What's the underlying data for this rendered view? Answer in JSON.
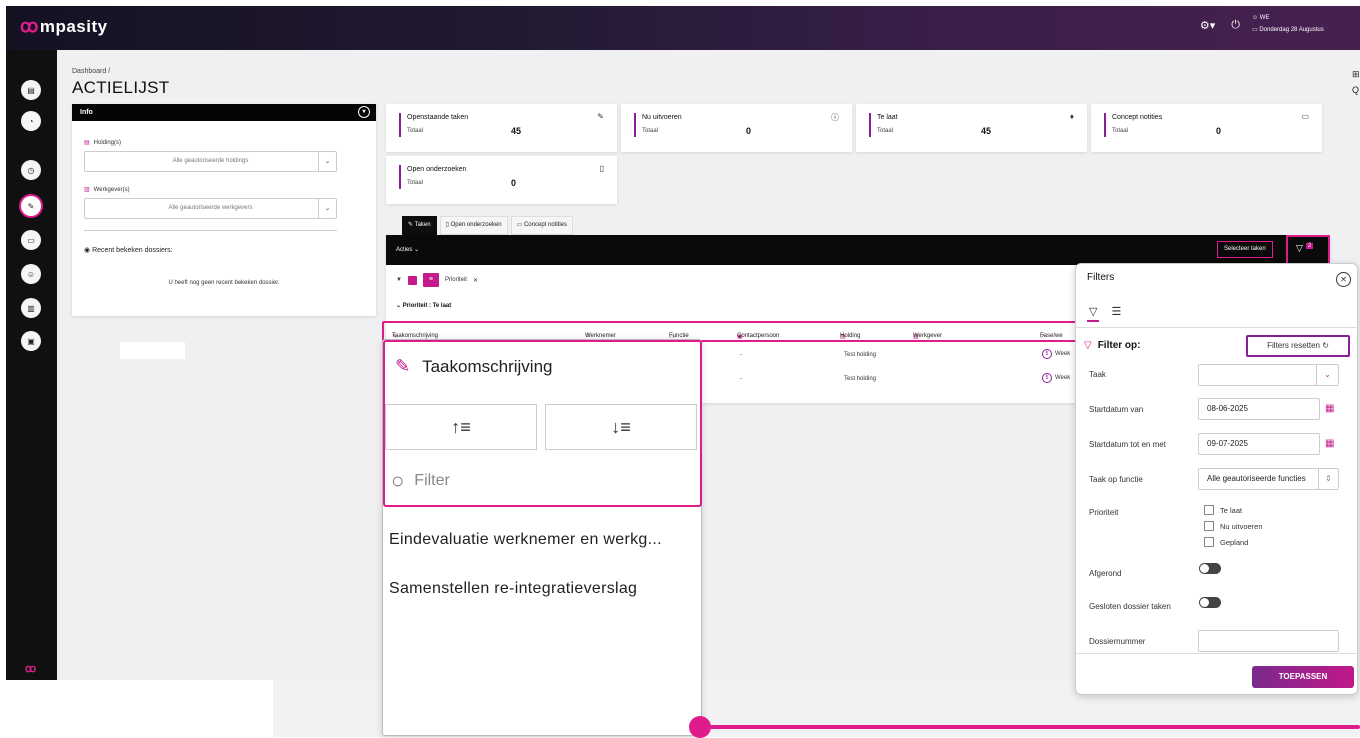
{
  "app": {
    "logo_text": "mpasity"
  },
  "topbar": {
    "user_initials": "WE",
    "date": "Donderdag 28 Augustus"
  },
  "page": {
    "breadcrumb": "Dashboard /",
    "title": "ACTIELIJST"
  },
  "info": {
    "title": "Info",
    "holding_label": "Holding(s)",
    "holding_value": "Alle geautoriseerde holdings",
    "werkgever_label": "Werkgever(s)",
    "werkgever_value": "Alle geautoriseerde werkgevers",
    "recent_label": "Recent bekeken dossiers:",
    "recent_empty": "U heeft nog geen recent bekeken dossier."
  },
  "stats": [
    {
      "title": "Openstaande taken",
      "sub": "Totaal",
      "value": "45",
      "icon": "edit-icon"
    },
    {
      "title": "Nu uitvoeren",
      "sub": "Totaal",
      "value": "0",
      "icon": "info-icon"
    },
    {
      "title": "Te laat",
      "sub": "Totaal",
      "value": "45",
      "icon": "bell-icon"
    },
    {
      "title": "Concept notities",
      "sub": "Totaal",
      "value": "0",
      "icon": "chat-icon"
    },
    {
      "title": "Open onderzoeken",
      "sub": "Totaal",
      "value": "0",
      "icon": "document-icon"
    }
  ],
  "tabs": [
    "Taken",
    "Open onderzoeken",
    "Concept notities"
  ],
  "toolbar": {
    "acties": "Acties",
    "select_tasks": "Selecteer taken",
    "filter_count": "2"
  },
  "grouping": {
    "chip_label": "Prioriteit",
    "group_title": "Prioriteit : Te laat"
  },
  "columns": [
    "Taakomschrijving",
    "Werknemer",
    "Functie",
    "Contactpersoon",
    "Holding",
    "Werkgever",
    "Fase/we"
  ],
  "rows": [
    {
      "contact": "-",
      "holding": "Test holding",
      "fase": "Week"
    },
    {
      "contact": "-",
      "holding": "Test holding",
      "fase": "Week"
    }
  ],
  "column_popup": {
    "title": "Taakomschrijving",
    "filter_placeholder": "Filter",
    "items": [
      "Eindevaluatie werknemer en werkg...",
      "Samenstellen re-integratieverslag"
    ]
  },
  "filters": {
    "title": "Filters",
    "filter_op": "Filter op:",
    "reset": "Filters resetten",
    "taak_label": "Taak",
    "start_van_label": "Startdatum van",
    "start_van": "08-06-2025",
    "start_tot_label": "Startdatum tot en met",
    "start_tot": "09-07-2025",
    "functie_label": "Taak op functie",
    "functie_value": "Alle geautoriseerde functies",
    "prioriteit_label": "Prioriteit",
    "prioriteit_options": [
      "Te laat",
      "Nu uitvoeren",
      "Gepland"
    ],
    "afgerond_label": "Afgerond",
    "gesloten_label": "Gesloten dossier taken",
    "dossier_label": "Dossiernummer",
    "apply": "TOEPASSEN"
  }
}
